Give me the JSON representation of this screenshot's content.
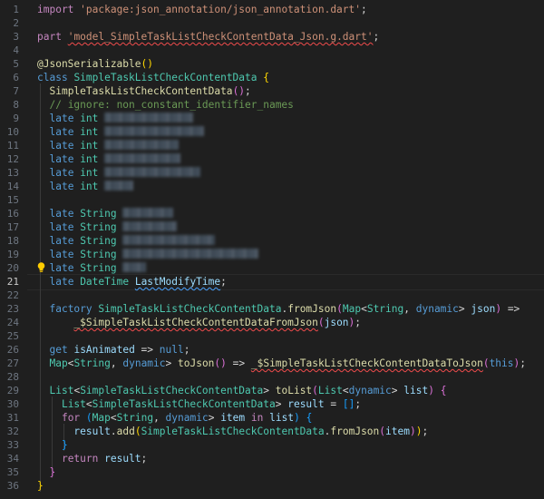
{
  "editor": {
    "language": "Dart",
    "active_line": 21,
    "lightbulb_icon": "lightbulb-icon",
    "lines": [
      {
        "n": "1",
        "tokens": [
          {
            "t": "import",
            "c": "ctl"
          },
          {
            "t": " "
          },
          {
            "t": "'package:json_annotation/json_annotation.dart'",
            "c": "str"
          },
          {
            "t": ";"
          }
        ]
      },
      {
        "n": "2",
        "tokens": []
      },
      {
        "n": "3",
        "tokens": [
          {
            "t": "part",
            "c": "ctl"
          },
          {
            "t": " "
          },
          {
            "t": "'model_SimpleTaskListCheckContentData_Json.g.dart'",
            "c": "str squig"
          },
          {
            "t": ";"
          }
        ]
      },
      {
        "n": "4",
        "tokens": []
      },
      {
        "n": "5",
        "tokens": [
          {
            "t": "@JsonSerializable",
            "c": "fn"
          },
          {
            "t": "()",
            "c": "brace-y"
          }
        ]
      },
      {
        "n": "6",
        "tokens": [
          {
            "t": "class",
            "c": "kw"
          },
          {
            "t": " "
          },
          {
            "t": "SimpleTaskListCheckContentData",
            "c": "ty"
          },
          {
            "t": " "
          },
          {
            "t": "{",
            "c": "brace-y"
          }
        ]
      },
      {
        "n": "7",
        "tokens": [
          {
            "t": "  "
          },
          {
            "t": "SimpleTaskListCheckContentData",
            "c": "fn"
          },
          {
            "t": "()",
            "c": "brace-p"
          },
          {
            "t": ";"
          }
        ]
      },
      {
        "n": "8",
        "tokens": [
          {
            "t": "  "
          },
          {
            "t": "// ignore: non_constant_identifier_names",
            "c": "cm"
          }
        ]
      },
      {
        "n": "9",
        "tokens": [
          {
            "t": "  "
          },
          {
            "t": "late",
            "c": "kw"
          },
          {
            "t": " "
          },
          {
            "t": "int",
            "c": "ty"
          },
          {
            "t": " "
          },
          {
            "blur": 98
          }
        ]
      },
      {
        "n": "10",
        "tokens": [
          {
            "t": "  "
          },
          {
            "t": "late",
            "c": "kw"
          },
          {
            "t": " "
          },
          {
            "t": "int",
            "c": "ty"
          },
          {
            "t": " "
          },
          {
            "blur": 110
          }
        ]
      },
      {
        "n": "11",
        "tokens": [
          {
            "t": "  "
          },
          {
            "t": "late",
            "c": "kw"
          },
          {
            "t": " "
          },
          {
            "t": "int",
            "c": "ty"
          },
          {
            "t": " "
          },
          {
            "blur": 82
          }
        ]
      },
      {
        "n": "12",
        "tokens": [
          {
            "t": "  "
          },
          {
            "t": "late",
            "c": "kw"
          },
          {
            "t": " "
          },
          {
            "t": "int",
            "c": "ty"
          },
          {
            "t": " "
          },
          {
            "blur": 84
          }
        ]
      },
      {
        "n": "13",
        "tokens": [
          {
            "t": "  "
          },
          {
            "t": "late",
            "c": "kw"
          },
          {
            "t": " "
          },
          {
            "t": "int",
            "c": "ty"
          },
          {
            "t": " "
          },
          {
            "blur": 106
          }
        ]
      },
      {
        "n": "14",
        "tokens": [
          {
            "t": "  "
          },
          {
            "t": "late",
            "c": "kw"
          },
          {
            "t": " "
          },
          {
            "t": "int",
            "c": "ty"
          },
          {
            "t": " "
          },
          {
            "blur": 32
          }
        ]
      },
      {
        "n": "15",
        "tokens": []
      },
      {
        "n": "16",
        "tokens": [
          {
            "t": "  "
          },
          {
            "t": "late",
            "c": "kw"
          },
          {
            "t": " "
          },
          {
            "t": "String",
            "c": "ty"
          },
          {
            "t": " "
          },
          {
            "blur": 56
          }
        ]
      },
      {
        "n": "17",
        "tokens": [
          {
            "t": "  "
          },
          {
            "t": "late",
            "c": "kw"
          },
          {
            "t": " "
          },
          {
            "t": "String",
            "c": "ty"
          },
          {
            "t": " "
          },
          {
            "blur": 60
          }
        ]
      },
      {
        "n": "18",
        "tokens": [
          {
            "t": "  "
          },
          {
            "t": "late",
            "c": "kw"
          },
          {
            "t": " "
          },
          {
            "t": "String",
            "c": "ty"
          },
          {
            "t": " "
          },
          {
            "blur": 102
          }
        ]
      },
      {
        "n": "19",
        "tokens": [
          {
            "t": "  "
          },
          {
            "t": "late",
            "c": "kw"
          },
          {
            "t": " "
          },
          {
            "t": "String",
            "c": "ty"
          },
          {
            "t": " "
          },
          {
            "blur": 150
          }
        ]
      },
      {
        "n": "20",
        "tokens": [
          {
            "t": "  "
          },
          {
            "t": "late",
            "c": "kw"
          },
          {
            "t": " "
          },
          {
            "t": "String",
            "c": "ty"
          },
          {
            "t": " "
          },
          {
            "blur": 26
          }
        ]
      },
      {
        "n": "21",
        "tokens": [
          {
            "t": "  "
          },
          {
            "t": "late",
            "c": "kw"
          },
          {
            "t": " "
          },
          {
            "t": "DateTime",
            "c": "ty"
          },
          {
            "t": " "
          },
          {
            "t": "LastModifyTime",
            "c": "var squig-b"
          },
          {
            "t": ";"
          }
        ]
      },
      {
        "n": "22",
        "tokens": []
      },
      {
        "n": "23",
        "tokens": [
          {
            "t": "  "
          },
          {
            "t": "factory",
            "c": "kw"
          },
          {
            "t": " "
          },
          {
            "t": "SimpleTaskListCheckContentData",
            "c": "ty"
          },
          {
            "t": "."
          },
          {
            "t": "fromJson",
            "c": "fn"
          },
          {
            "t": "(",
            "c": "brace-p"
          },
          {
            "t": "Map",
            "c": "ty"
          },
          {
            "t": "<"
          },
          {
            "t": "String",
            "c": "ty"
          },
          {
            "t": ", "
          },
          {
            "t": "dynamic",
            "c": "kw"
          },
          {
            "t": "> "
          },
          {
            "t": "json",
            "c": "var"
          },
          {
            "t": ")",
            "c": "brace-p"
          },
          {
            "t": " =>"
          }
        ]
      },
      {
        "n": "24",
        "tokens": [
          {
            "t": "      "
          },
          {
            "t": "_$SimpleTaskListCheckContentDataFromJson",
            "c": "fn squig"
          },
          {
            "t": "(",
            "c": "brace-p"
          },
          {
            "t": "json",
            "c": "var"
          },
          {
            "t": ")",
            "c": "brace-p"
          },
          {
            "t": ";"
          }
        ]
      },
      {
        "n": "25",
        "tokens": []
      },
      {
        "n": "26",
        "tokens": [
          {
            "t": "  "
          },
          {
            "t": "get",
            "c": "kw"
          },
          {
            "t": " "
          },
          {
            "t": "isAnimated",
            "c": "var"
          },
          {
            "t": " => "
          },
          {
            "t": "null",
            "c": "kw"
          },
          {
            "t": ";"
          }
        ]
      },
      {
        "n": "27",
        "tokens": [
          {
            "t": "  "
          },
          {
            "t": "Map",
            "c": "ty"
          },
          {
            "t": "<"
          },
          {
            "t": "String",
            "c": "ty"
          },
          {
            "t": ", "
          },
          {
            "t": "dynamic",
            "c": "kw"
          },
          {
            "t": "> "
          },
          {
            "t": "toJson",
            "c": "fn"
          },
          {
            "t": "()",
            "c": "brace-p"
          },
          {
            "t": " => "
          },
          {
            "t": "_$SimpleTaskListCheckContentDataToJson",
            "c": "fn squig"
          },
          {
            "t": "(",
            "c": "brace-p"
          },
          {
            "t": "this",
            "c": "kw"
          },
          {
            "t": ")",
            "c": "brace-p"
          },
          {
            "t": ";"
          }
        ]
      },
      {
        "n": "28",
        "tokens": []
      },
      {
        "n": "29",
        "tokens": [
          {
            "t": "  "
          },
          {
            "t": "List",
            "c": "ty"
          },
          {
            "t": "<"
          },
          {
            "t": "SimpleTaskListCheckContentData",
            "c": "ty"
          },
          {
            "t": "> "
          },
          {
            "t": "toList",
            "c": "fn"
          },
          {
            "t": "(",
            "c": "brace-p"
          },
          {
            "t": "List",
            "c": "ty"
          },
          {
            "t": "<"
          },
          {
            "t": "dynamic",
            "c": "kw"
          },
          {
            "t": "> "
          },
          {
            "t": "list",
            "c": "var"
          },
          {
            "t": ")",
            "c": "brace-p"
          },
          {
            "t": " "
          },
          {
            "t": "{",
            "c": "brace-p"
          }
        ]
      },
      {
        "n": "30",
        "tokens": [
          {
            "t": "    "
          },
          {
            "t": "List",
            "c": "ty"
          },
          {
            "t": "<"
          },
          {
            "t": "SimpleTaskListCheckContentData",
            "c": "ty"
          },
          {
            "t": "> "
          },
          {
            "t": "result",
            "c": "var"
          },
          {
            "t": " = "
          },
          {
            "t": "[]",
            "c": "brace-b"
          },
          {
            "t": ";"
          }
        ]
      },
      {
        "n": "31",
        "tokens": [
          {
            "t": "    "
          },
          {
            "t": "for",
            "c": "ctl"
          },
          {
            "t": " "
          },
          {
            "t": "(",
            "c": "brace-b"
          },
          {
            "t": "Map",
            "c": "ty"
          },
          {
            "t": "<"
          },
          {
            "t": "String",
            "c": "ty"
          },
          {
            "t": ", "
          },
          {
            "t": "dynamic",
            "c": "kw"
          },
          {
            "t": "> "
          },
          {
            "t": "item",
            "c": "var"
          },
          {
            "t": " "
          },
          {
            "t": "in",
            "c": "ctl"
          },
          {
            "t": " "
          },
          {
            "t": "list",
            "c": "var"
          },
          {
            "t": ")",
            "c": "brace-b"
          },
          {
            "t": " "
          },
          {
            "t": "{",
            "c": "brace-b"
          }
        ]
      },
      {
        "n": "32",
        "tokens": [
          {
            "t": "      "
          },
          {
            "t": "result",
            "c": "var"
          },
          {
            "t": "."
          },
          {
            "t": "add",
            "c": "fn"
          },
          {
            "t": "(",
            "c": "brace-y"
          },
          {
            "t": "SimpleTaskListCheckContentData",
            "c": "ty"
          },
          {
            "t": "."
          },
          {
            "t": "fromJson",
            "c": "fn"
          },
          {
            "t": "(",
            "c": "brace-p"
          },
          {
            "t": "item",
            "c": "var"
          },
          {
            "t": ")",
            "c": "brace-p"
          },
          {
            "t": ")",
            "c": "brace-y"
          },
          {
            "t": ";"
          }
        ]
      },
      {
        "n": "33",
        "tokens": [
          {
            "t": "    "
          },
          {
            "t": "}",
            "c": "brace-b"
          }
        ]
      },
      {
        "n": "34",
        "tokens": [
          {
            "t": "    "
          },
          {
            "t": "return",
            "c": "ctl"
          },
          {
            "t": " "
          },
          {
            "t": "result",
            "c": "var"
          },
          {
            "t": ";"
          }
        ]
      },
      {
        "n": "35",
        "tokens": [
          {
            "t": "  "
          },
          {
            "t": "}",
            "c": "brace-p"
          }
        ]
      },
      {
        "n": "36",
        "tokens": [
          {
            "t": "}",
            "c": "brace-y"
          }
        ]
      }
    ]
  }
}
